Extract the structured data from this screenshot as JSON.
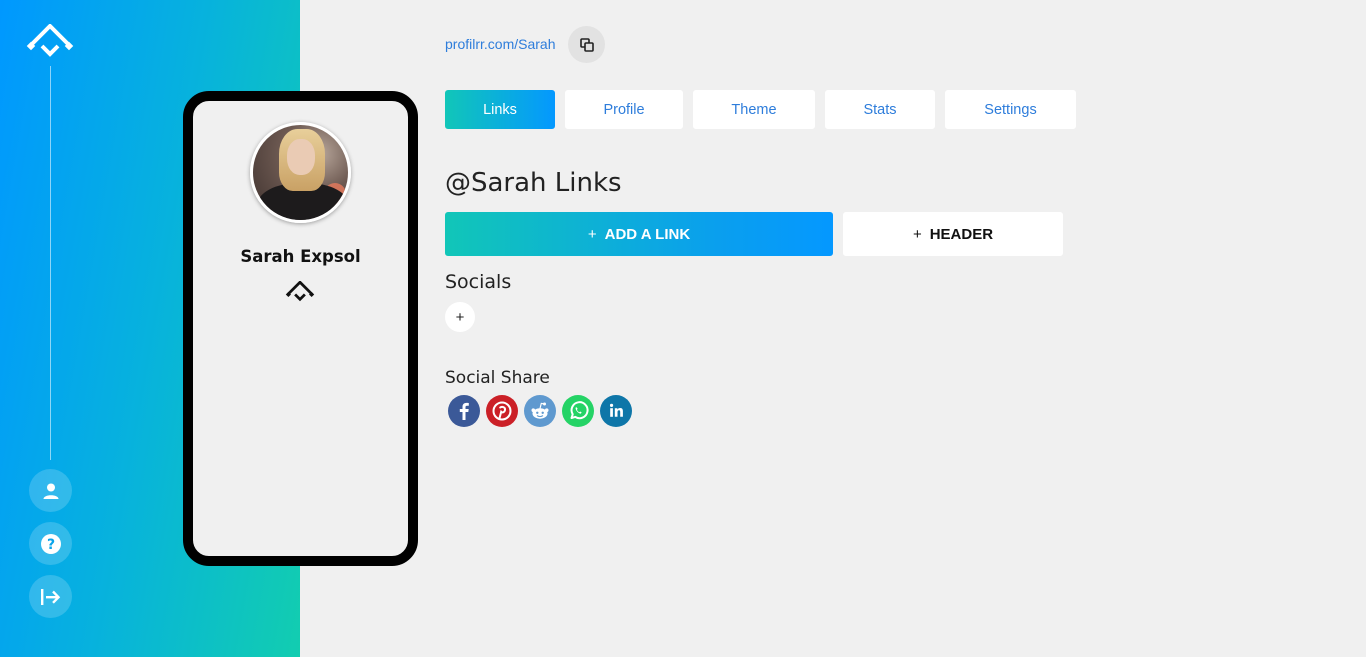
{
  "app": {
    "logo_icon": "profilrr-logo-icon",
    "accent_colors": {
      "gradient_start": "#0098ff",
      "gradient_end": "#12cdb0",
      "link_blue": "#2e7ddb"
    }
  },
  "sidebar": {
    "buttons": [
      {
        "name": "account",
        "icon": "user-icon"
      },
      {
        "name": "help",
        "icon": "question-icon"
      },
      {
        "name": "logout",
        "icon": "logout-arrow-icon"
      }
    ]
  },
  "preview": {
    "name": "Sarah Expsol",
    "logo_icon": "profilrr-logo-icon"
  },
  "profile_url": {
    "text": "profilrr.com/Sarah",
    "copy_icon": "copy-icon"
  },
  "tabs": [
    {
      "label": "Links",
      "active": true
    },
    {
      "label": "Profile",
      "active": false
    },
    {
      "label": "Theme",
      "active": false
    },
    {
      "label": "Stats",
      "active": false
    },
    {
      "label": "Settings",
      "active": false
    }
  ],
  "main": {
    "title": "@Sarah Links",
    "add_link": {
      "plus": "+",
      "label": "ADD A LINK"
    },
    "add_header": {
      "plus": "+",
      "label": "HEADER"
    },
    "socials": {
      "title": "Socials",
      "add_label": "+"
    },
    "social_share": {
      "title": "Social Share",
      "networks": [
        {
          "name": "facebook",
          "icon": "facebook-icon",
          "color": "#3b5998"
        },
        {
          "name": "pinterest",
          "icon": "pinterest-icon",
          "color": "#cb2027"
        },
        {
          "name": "reddit",
          "icon": "reddit-icon",
          "color": "#5f99cf"
        },
        {
          "name": "whatsapp",
          "icon": "whatsapp-icon",
          "color": "#25d366"
        },
        {
          "name": "linkedin",
          "icon": "linkedin-icon",
          "color": "#0e76a8"
        }
      ]
    }
  }
}
